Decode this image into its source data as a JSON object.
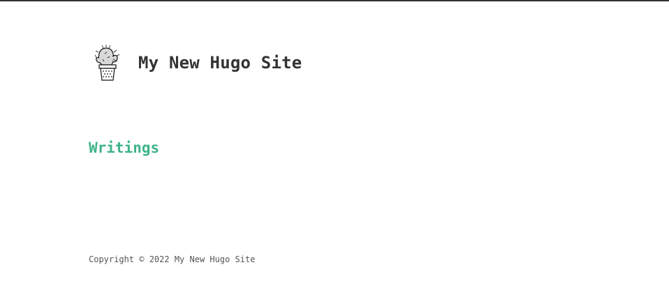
{
  "header": {
    "logo_icon": "cactus-pot-icon",
    "site_title": "My New Hugo Site"
  },
  "main": {
    "section_link": "Writings"
  },
  "footer": {
    "copyright": "Copyright © 2022 My New Hugo Site"
  },
  "colors": {
    "accent": "#3eb489",
    "text": "#333333",
    "footer_text": "#555555",
    "top_border": "#333333"
  }
}
